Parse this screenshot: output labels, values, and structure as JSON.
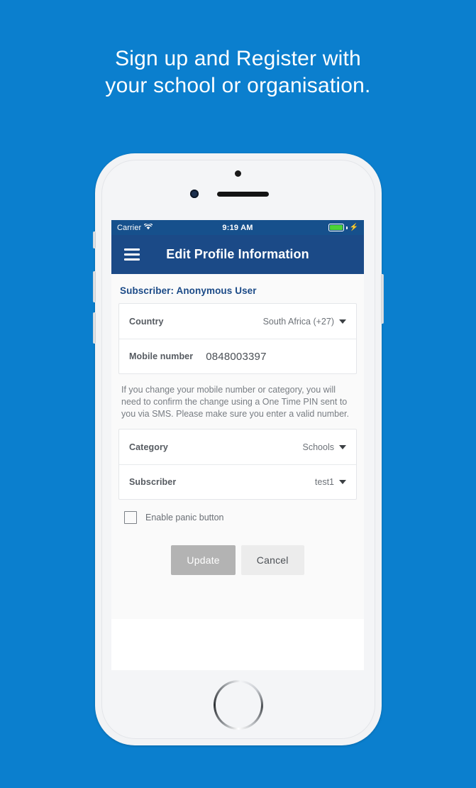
{
  "headline": {
    "line1": "Sign up and Register with",
    "line2": "your school or organisation."
  },
  "colors": {
    "page_background": "#0b7fce",
    "navbar": "#1b4a87",
    "statusbar": "#16508c",
    "accent_text": "#1b4a87",
    "battery_green": "#4cd336",
    "update_button": "#b3b3b3",
    "cancel_button": "#ececec"
  },
  "statusbar": {
    "carrier": "Carrier",
    "wifi_icon": "wifi-icon",
    "time": "9:19 AM",
    "battery_icon": "battery-icon",
    "charging_icon": "⚡"
  },
  "navbar": {
    "menu_icon": "hamburger-menu-icon",
    "title": "Edit Profile Information"
  },
  "form": {
    "section_title": "Subscriber: Anonymous User",
    "helper_text": "If you change your mobile number or category, you will need to confirm the change using a One Time PIN sent to you via SMS. Please make sure you enter a valid number.",
    "rows_top": [
      {
        "label": "Country",
        "value": "South Africa (+27)",
        "type": "dropdown"
      },
      {
        "label": "Mobile number",
        "value": "0848003397",
        "type": "text"
      }
    ],
    "rows_bottom": [
      {
        "label": "Category",
        "value": "Schools",
        "type": "dropdown"
      },
      {
        "label": "Subscriber",
        "value": "test1",
        "type": "dropdown"
      }
    ],
    "checkbox": {
      "label": "Enable panic button",
      "checked": false
    },
    "buttons": {
      "update": "Update",
      "cancel": "Cancel"
    }
  }
}
